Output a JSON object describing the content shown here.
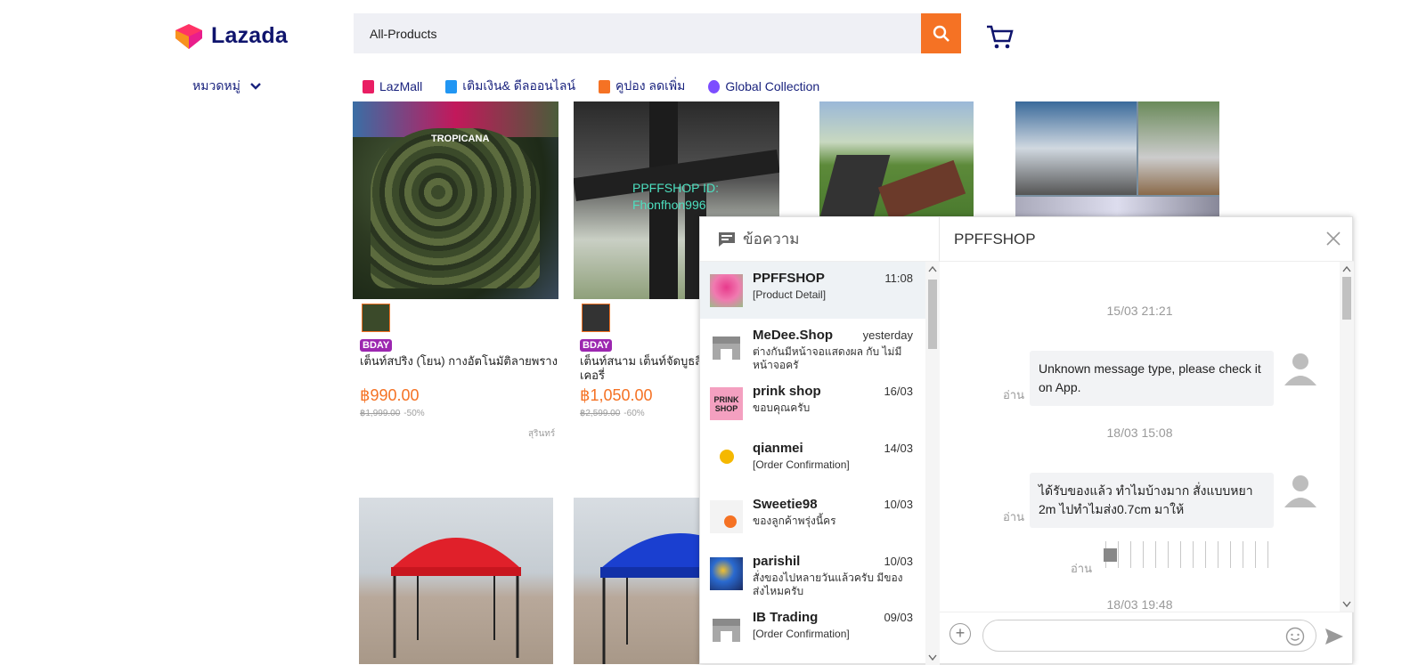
{
  "header": {
    "logo_text": "Lazada",
    "search_value": "All-Products",
    "categories_label": "หมวดหมู่"
  },
  "nav": [
    {
      "label": "LazMall",
      "color": "#e91e63"
    },
    {
      "label": "เติมเงิน& ดีลออนไลน์",
      "color": "#2196f3"
    },
    {
      "label": "คูปอง ลดเพิ่ม",
      "color": "#f57224"
    },
    {
      "label": "Global Collection",
      "color": "#7c4dff"
    }
  ],
  "products": [
    {
      "badge": "BDAY",
      "title": "เต็นท์สปริง (โยน) กางอัตโนมัติลายพราง",
      "price": "฿990.00",
      "original": "฿1,999.00",
      "discount": "-50%",
      "location": "สุรินทร์",
      "image_text": "TROPICANA"
    },
    {
      "badge": "BDAY",
      "title": "เต็นท์สนาม เต็นท์จัดบูธสีเ เคอรี่",
      "price": "฿1,050.00",
      "original": "฿2,599.00",
      "discount": "-60%",
      "image_text": "PPFFSHOP ID: Fhonfhon996"
    }
  ],
  "chat": {
    "title": "ข้อความ",
    "active_shop": "PPFFSHOP",
    "conversations": [
      {
        "name": "PPFFSHOP",
        "time": "11:08",
        "message": "[Product Detail]",
        "avatar": "tent-thumb"
      },
      {
        "name": "MeDee.Shop",
        "time": "yesterday",
        "message": "ต่างกันมีหน้าจอแสดงผล กับ ไม่มีหน้าจอครั",
        "avatar": "shop-icon"
      },
      {
        "name": "prink shop",
        "time": "16/03",
        "message": "ขอบคุณครับ",
        "avatar": "prink-logo",
        "avatar_text": "PRINK SHOP"
      },
      {
        "name": "qianmei",
        "time": "14/03",
        "message": "[Order Confirmation]",
        "avatar": "qianmei-logo"
      },
      {
        "name": "Sweetie98",
        "time": "10/03",
        "message": "ของลูกค้าพรุ่งนี้คร",
        "avatar": "sweetie-logo"
      },
      {
        "name": "parishil",
        "time": "10/03",
        "message": "สั่งของไปหลายวันแล้วครับ มีของส่งไหมครับ",
        "avatar": "parishil-logo"
      },
      {
        "name": "IB Trading",
        "time": "09/03",
        "message": "[Order Confirmation]",
        "avatar": "shop-icon"
      }
    ],
    "messages": [
      {
        "type": "timestamp",
        "text": "15/03 21:21"
      },
      {
        "type": "bubble",
        "text": "Unknown message type, please check it on App.",
        "status": "อ่าน"
      },
      {
        "type": "timestamp",
        "text": "18/03 15:08"
      },
      {
        "type": "bubble",
        "text": "ได้รับของแล้ว ทำไมบ้างมาก สั่งแบบหยา 2m ไปทำไมส่ง0.7cm มาให้",
        "status": "อ่าน"
      },
      {
        "type": "image",
        "status": "อ่าน"
      },
      {
        "type": "timestamp",
        "text": "18/03 19:48"
      }
    ],
    "input_placeholder": ""
  },
  "colors": {
    "accent": "#f57224",
    "brand": "#0f146d",
    "link": "#1a237e"
  }
}
